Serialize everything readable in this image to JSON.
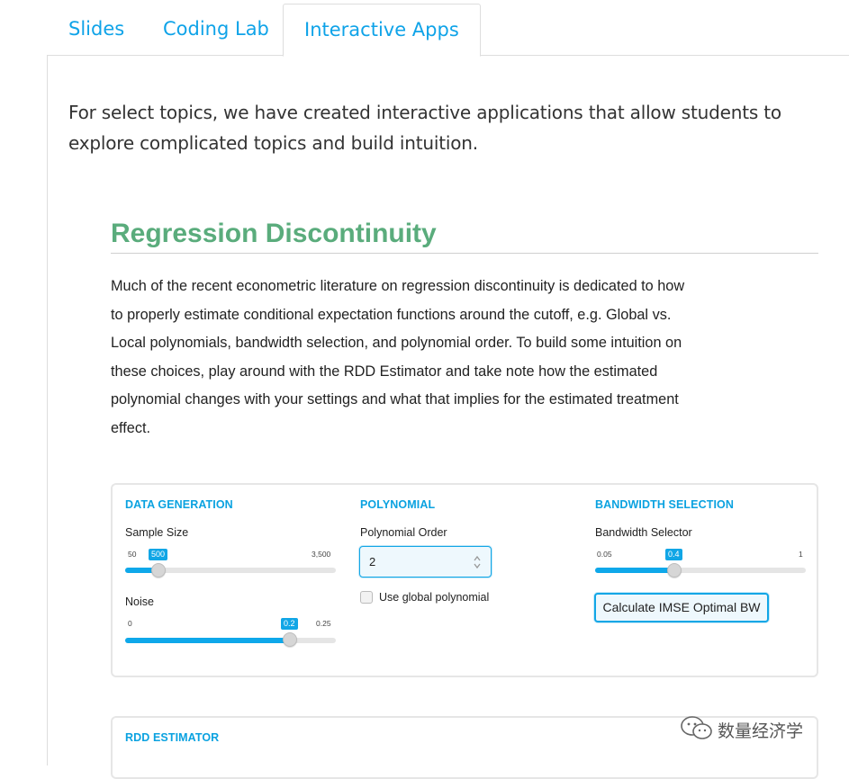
{
  "tabs": [
    {
      "label": "Slides"
    },
    {
      "label": "Coding Lab"
    },
    {
      "label": "Interactive Apps"
    }
  ],
  "intro": "For select topics, we have created interactive applications that allow students to explore complicated topics and build intuition.",
  "app": {
    "title": "Regression Discontinuity",
    "description": "Much of the recent econometric literature on regression discontinuity is dedicated to how to properly estimate conditional expectation functions around the cutoff, e.g. Global vs. Local polynomials, bandwidth selection, and polynomial order. To build some intuition on these choices, play around with the RDD Estimator and take note how the estimated polynomial changes with your settings and what that implies for the estimated treatment effect.",
    "title_color": "#5aac7c",
    "accent_color": "#0ea8ea",
    "data_generation": {
      "heading": "DATA GENERATION",
      "sample_size": {
        "label": "Sample Size",
        "min": "50",
        "max": "3,500",
        "value": "500",
        "fraction": 0.13
      },
      "noise": {
        "label": "Noise",
        "min": "0",
        "max": "0.25",
        "value": "0.2",
        "fraction": 0.8
      }
    },
    "polynomial": {
      "heading": "POLYNOMIAL",
      "order_label": "Polynomial Order",
      "order_value": "2",
      "global_checkbox_label": "Use global polynomial",
      "global_checked": false
    },
    "bandwidth": {
      "heading": "BANDWIDTH SELECTION",
      "selector": {
        "label": "Bandwidth Selector",
        "min": "0.05",
        "max": "1",
        "value": "0.4",
        "fraction": 0.37
      },
      "button_label": "Calculate IMSE Optimal BW"
    },
    "rdd_estimator": {
      "heading": "RDD ESTIMATOR"
    }
  },
  "watermark": {
    "text": "数量经济学",
    "icon": "wechat-icon"
  }
}
